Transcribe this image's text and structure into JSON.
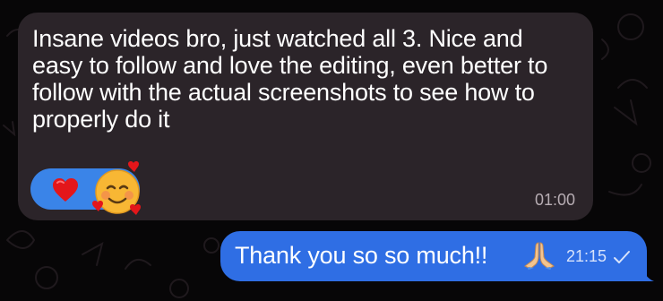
{
  "incoming_message": {
    "text": "Insane videos bro, just watched all 3. Nice and easy to follow and love the editing, even better to follow with the actual screenshots to see how to properly do it",
    "time": "01:00",
    "reactions": [
      "red-heart",
      "smiling-face-with-hearts"
    ],
    "bubble_color": "#2b2429",
    "reaction_pill_color": "#3a84e8"
  },
  "outgoing_message": {
    "text": "Thank you so so much!!",
    "emoji": "folded-hands",
    "time": "21:15",
    "status_icon": "check-icon",
    "bubble_color": "#2f6ee4"
  }
}
